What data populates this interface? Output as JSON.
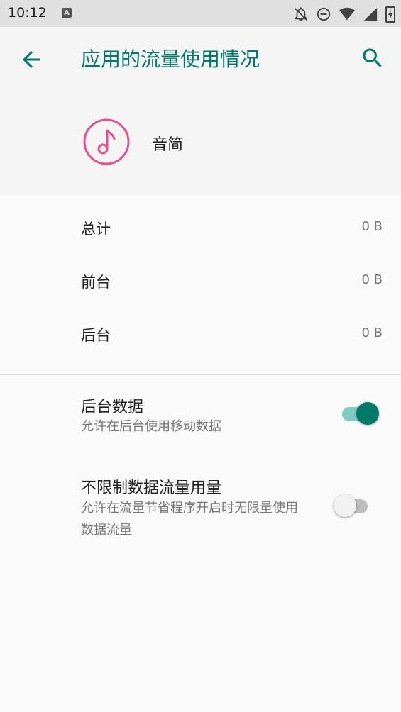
{
  "status_bar": {
    "time": "10:12",
    "notification_letter": "A"
  },
  "app_bar": {
    "title": "应用的流量使用情况"
  },
  "app": {
    "name": "音简"
  },
  "usage": [
    {
      "label": "总计",
      "value": "0 B"
    },
    {
      "label": "前台",
      "value": "0 B"
    },
    {
      "label": "后台",
      "value": "0 B"
    }
  ],
  "preferences": {
    "background_data": {
      "title": "后台数据",
      "summary": "允许在后台使用移动数据",
      "enabled": true
    },
    "unrestricted_data": {
      "title": "不限制数据流量用量",
      "summary": "允许在流量节省程序开启时无限量使用数据流量",
      "enabled": false
    }
  },
  "colors": {
    "accent": "#00796b",
    "app_icon": "#e9508a",
    "switch_on_track": "#80cbc4",
    "switch_off_track": "#bdbdbd"
  }
}
